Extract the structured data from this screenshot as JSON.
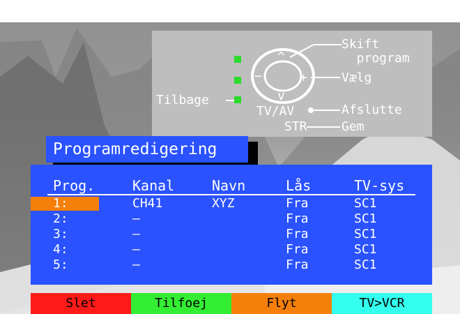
{
  "help_panel": {
    "change_program": "Skift\n  program",
    "select": "Vælg",
    "back": "Tilbage",
    "tv_av": "TV/AV",
    "exit": "Afslutte",
    "str": "STR",
    "save": "Gem",
    "up_symbol": "^",
    "down_symbol": "v",
    "minus_symbol": "−",
    "plus_symbol": "+",
    "indicator_color": "#2bdc2b"
  },
  "title": "Programredigering",
  "table": {
    "headers": [
      "Prog.",
      "Kanal",
      "Navn",
      "Lås",
      "TV-sys"
    ],
    "rows": [
      {
        "prog": "1:",
        "kanal": "CH41",
        "navn": "XYZ",
        "laas": "Fra",
        "tvsys": "SC1",
        "selected": true
      },
      {
        "prog": "2:",
        "kanal": "–",
        "navn": "",
        "laas": "Fra",
        "tvsys": "SC1"
      },
      {
        "prog": "3:",
        "kanal": "–",
        "navn": "",
        "laas": "Fra",
        "tvsys": "SC1"
      },
      {
        "prog": "4:",
        "kanal": "–",
        "navn": "",
        "laas": "Fra",
        "tvsys": "SC1"
      },
      {
        "prog": "5:",
        "kanal": "–",
        "navn": "",
        "laas": "Fra",
        "tvsys": "SC1"
      }
    ]
  },
  "buttons": [
    {
      "label": "Slet",
      "color": "#ff1a1a",
      "text_color": "#000000"
    },
    {
      "label": "Tilfoej",
      "color": "#33ee33",
      "text_color": "#000000"
    },
    {
      "label": "Flyt",
      "color": "#f47f0b",
      "text_color": "#000000"
    },
    {
      "label": "TV>VCR",
      "color": "#33ffee",
      "text_color": "#000000"
    }
  ],
  "colors": {
    "menu_blue": "#2a52ff",
    "selection_orange": "#f47f0b",
    "panel_gray": "#bebebe"
  }
}
